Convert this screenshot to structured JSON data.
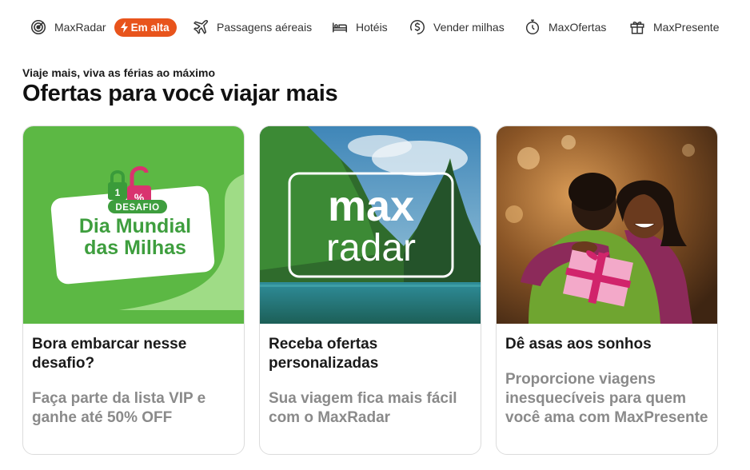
{
  "nav": {
    "maxradar": {
      "label": "MaxRadar",
      "badge": "Em alta",
      "icon": "radar-icon"
    },
    "flights": {
      "label": "Passagens aéreais",
      "icon": "airplane-icon"
    },
    "hotels": {
      "label": "Hotéis",
      "icon": "bed-icon"
    },
    "sell_miles": {
      "label": "Vender milhas",
      "icon": "dollar-circle-icon"
    },
    "maxofertas": {
      "label": "MaxOfertas",
      "icon": "stopwatch-icon"
    },
    "maxpresente": {
      "label": "MaxPresente",
      "icon": "gift-icon"
    }
  },
  "section": {
    "kicker": "Viaje mais, viva as férias ao máximo",
    "title": "Ofertas para você viajar mais"
  },
  "cards": [
    {
      "image": {
        "tag": "DESAFIO",
        "line1": "Dia Mundial",
        "line2": "das Milhas",
        "lock_text_1": "1",
        "lock_text_2": "%"
      },
      "title": "Bora embarcar nesse desafio?",
      "description": "Faça parte da lista VIP e ganhe até 50% OFF"
    },
    {
      "image": {
        "line1": "max",
        "line2": "radar"
      },
      "title": "Receba ofertas personalizadas",
      "description": "Sua viagem fica mais fácil com o MaxRadar"
    },
    {
      "image": {},
      "title": "Dê asas aos sonhos",
      "description": "Proporcione viagens inesquecíveis para quem você ama com MaxPresente"
    }
  ],
  "colors": {
    "accent_orange": "#e8541c",
    "green_bg": "#5cb844",
    "muted_text": "#8a8a8a"
  }
}
